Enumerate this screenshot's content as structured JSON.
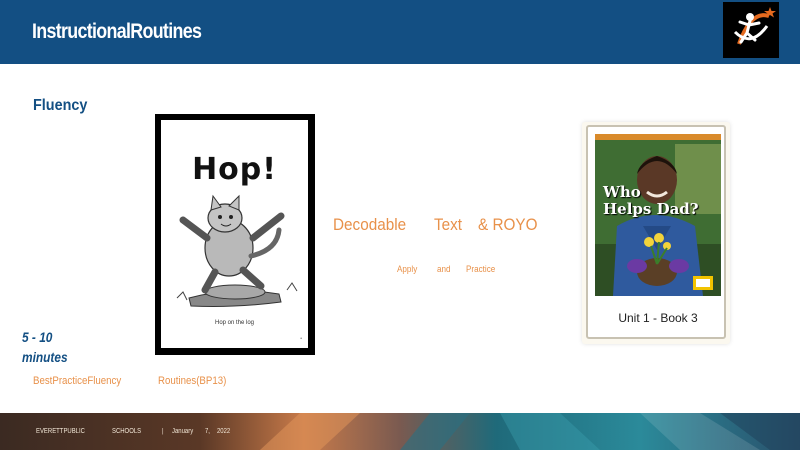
{
  "header": {
    "title": "InstructionalRoutines"
  },
  "section": {
    "title": "Fluency"
  },
  "book_hop": {
    "title": "Hop!",
    "caption": "Hop on the log"
  },
  "middle": {
    "decodable": "Decodable",
    "text": "Text",
    "royo": "& ROYO",
    "apply": "Apply",
    "and": "and",
    "practice": "Practice"
  },
  "book_royo": {
    "cover_title_line1": "Who",
    "cover_title_line2": "Helps Dad?",
    "label": "Unit 1 - Book 3"
  },
  "timing": {
    "line1": "5 - 10",
    "line2": "minutes"
  },
  "links": {
    "best_practice": "BestPracticeFluency",
    "routines": "Routines(BP13)"
  },
  "footer": {
    "org1": "EVERETTPUBLIC",
    "org2": "SCHOOLS",
    "sep": "|",
    "month": "January",
    "day": "7,",
    "year": "2022"
  },
  "colors": {
    "brand_blue": "#134f83",
    "accent_orange": "#e8914a"
  }
}
